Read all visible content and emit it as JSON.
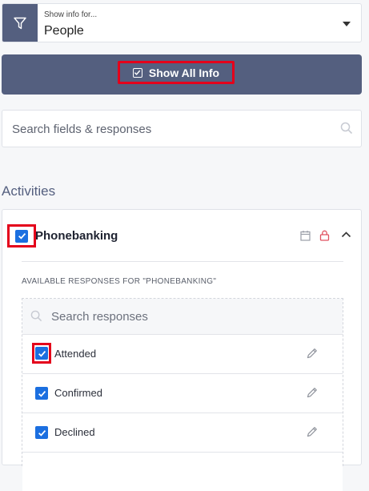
{
  "picker": {
    "caption": "Show info for...",
    "value": "People"
  },
  "show_all": {
    "label": "Show All Info"
  },
  "search": {
    "placeholder": "Search fields & responses"
  },
  "section": {
    "title": "Activities"
  },
  "activity": {
    "title": "Phonebanking",
    "available_label": "AVAILABLE RESPONSES FOR \"PHONEBANKING\"",
    "search_placeholder": "Search responses",
    "responses": [
      {
        "label": "Attended",
        "checked": true
      },
      {
        "label": "Confirmed",
        "checked": true
      },
      {
        "label": "Declined",
        "checked": true
      }
    ]
  },
  "colors": {
    "accent": "#545f7f",
    "checkbox": "#1b6fe0",
    "highlight": "#e4001b",
    "lock": "#e05260"
  },
  "icons": [
    "filter-icon",
    "caret-down-icon",
    "checkbox-outline-icon",
    "search-icon",
    "calendar-icon",
    "lock-icon",
    "chevron-up-icon",
    "check-icon",
    "pencil-icon"
  ]
}
